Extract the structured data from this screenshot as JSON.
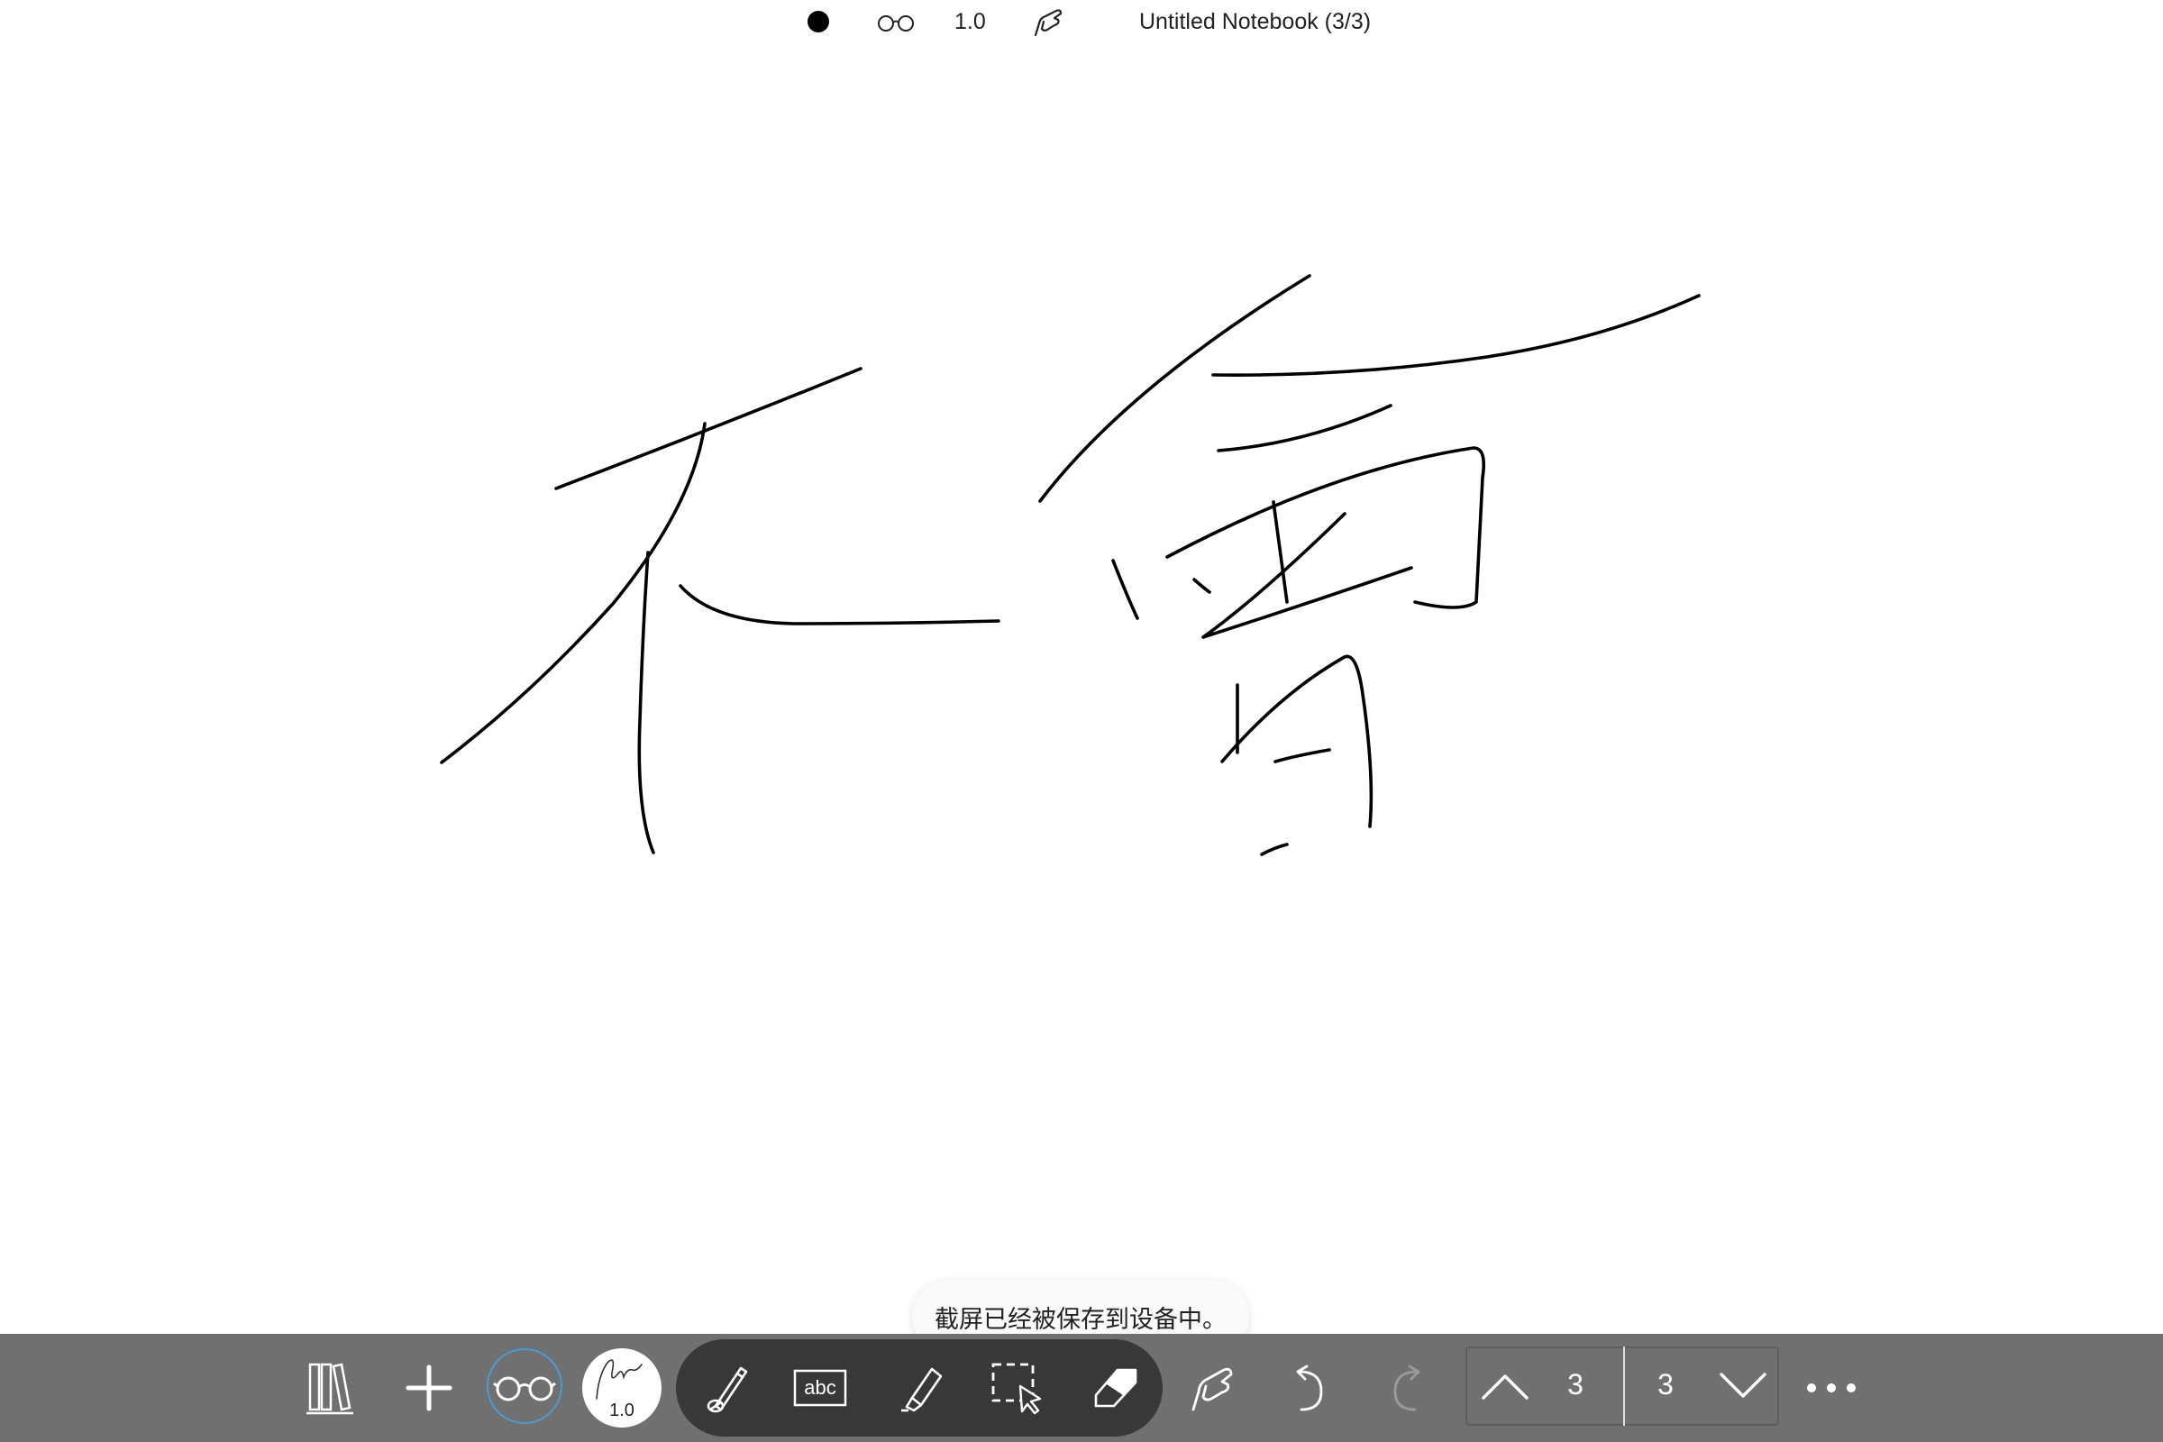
{
  "top_bar": {
    "zoom": "1.0",
    "title": "Untitled Notebook (3/3)",
    "icons": [
      "ink-dot-icon",
      "glasses-icon",
      "touch-hand-icon"
    ]
  },
  "toast": {
    "message": "截屏已经被保存到设备中。"
  },
  "toolbar": {
    "pen_size": "1.0",
    "tools": [
      "library-icon",
      "add-icon",
      "glasses-icon",
      "pen-size-icon",
      "pencil-tool-icon",
      "text-tool-icon",
      "highlighter-tool-icon",
      "lasso-select-icon",
      "eraser-tool-icon",
      "touch-hand-icon",
      "undo-icon",
      "redo-icon",
      "page-up-icon",
      "page-down-icon",
      "more-icon"
    ],
    "current_page": "3",
    "total_pages": "3",
    "accent_color": "#4a9bd6",
    "toolbar_color": "#707070",
    "pill_color": "#383838"
  }
}
